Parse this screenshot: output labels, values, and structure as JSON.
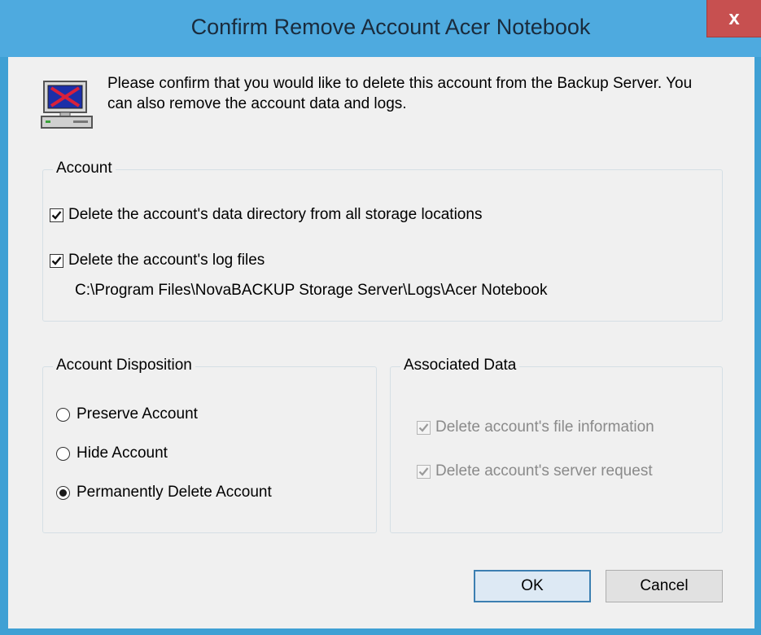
{
  "window": {
    "title": "Confirm Remove Account Acer Notebook",
    "close_label": "x"
  },
  "intro": {
    "text": "Please confirm that you would like to delete this account from the Backup Server.  You can also remove the account data and logs."
  },
  "account_group": {
    "title": "Account",
    "delete_data_dir_label": "Delete the account's data directory from all storage locations",
    "delete_data_dir_checked": true,
    "delete_logs_label": "Delete the account's log files",
    "delete_logs_checked": true,
    "log_path": "C:\\Program Files\\NovaBACKUP Storage Server\\Logs\\Acer Notebook"
  },
  "disposition_group": {
    "title": "Account Disposition",
    "options": [
      {
        "label": "Preserve Account",
        "selected": false
      },
      {
        "label": "Hide Account",
        "selected": false
      },
      {
        "label": "Permanently Delete Account",
        "selected": true
      }
    ]
  },
  "associated_group": {
    "title": "Associated Data",
    "items": [
      {
        "label": "Delete account's file information",
        "checked": true,
        "enabled": false
      },
      {
        "label": "Delete account's server request",
        "checked": true,
        "enabled": false
      }
    ]
  },
  "buttons": {
    "ok_label": "OK",
    "cancel_label": "Cancel"
  },
  "colors": {
    "title_bar": "#4eaadf",
    "close_button": "#c75050",
    "dialog_background": "#f0f0f0"
  }
}
